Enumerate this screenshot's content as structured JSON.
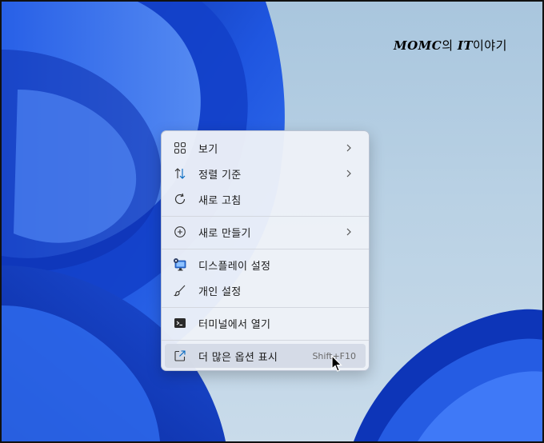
{
  "watermark": {
    "brand": "MOMC",
    "particle": "의",
    "it": "IT",
    "rest": "이야기"
  },
  "context_menu": {
    "items": [
      {
        "label": "보기",
        "icon": "grid-view-icon",
        "has_submenu": true
      },
      {
        "label": "정렬 기준",
        "icon": "sort-arrows-icon",
        "has_submenu": true
      },
      {
        "label": "새로 고침",
        "icon": "refresh-icon",
        "has_submenu": false
      },
      {
        "label": "새로 만들기",
        "icon": "add-circle-icon",
        "has_submenu": true
      },
      {
        "label": "디스플레이 설정",
        "icon": "display-settings-icon",
        "has_submenu": false
      },
      {
        "label": "개인 설정",
        "icon": "brush-icon",
        "has_submenu": false
      },
      {
        "label": "터미널에서 열기",
        "icon": "terminal-icon",
        "has_submenu": false
      },
      {
        "label": "더 많은 옵션 표시",
        "icon": "open-external-icon",
        "shortcut": "Shift+F10"
      }
    ]
  },
  "colors": {
    "accent": "#0067c0",
    "wallpaper_blue": "#1a4fd6",
    "menu_bg": "#eef1f8"
  }
}
